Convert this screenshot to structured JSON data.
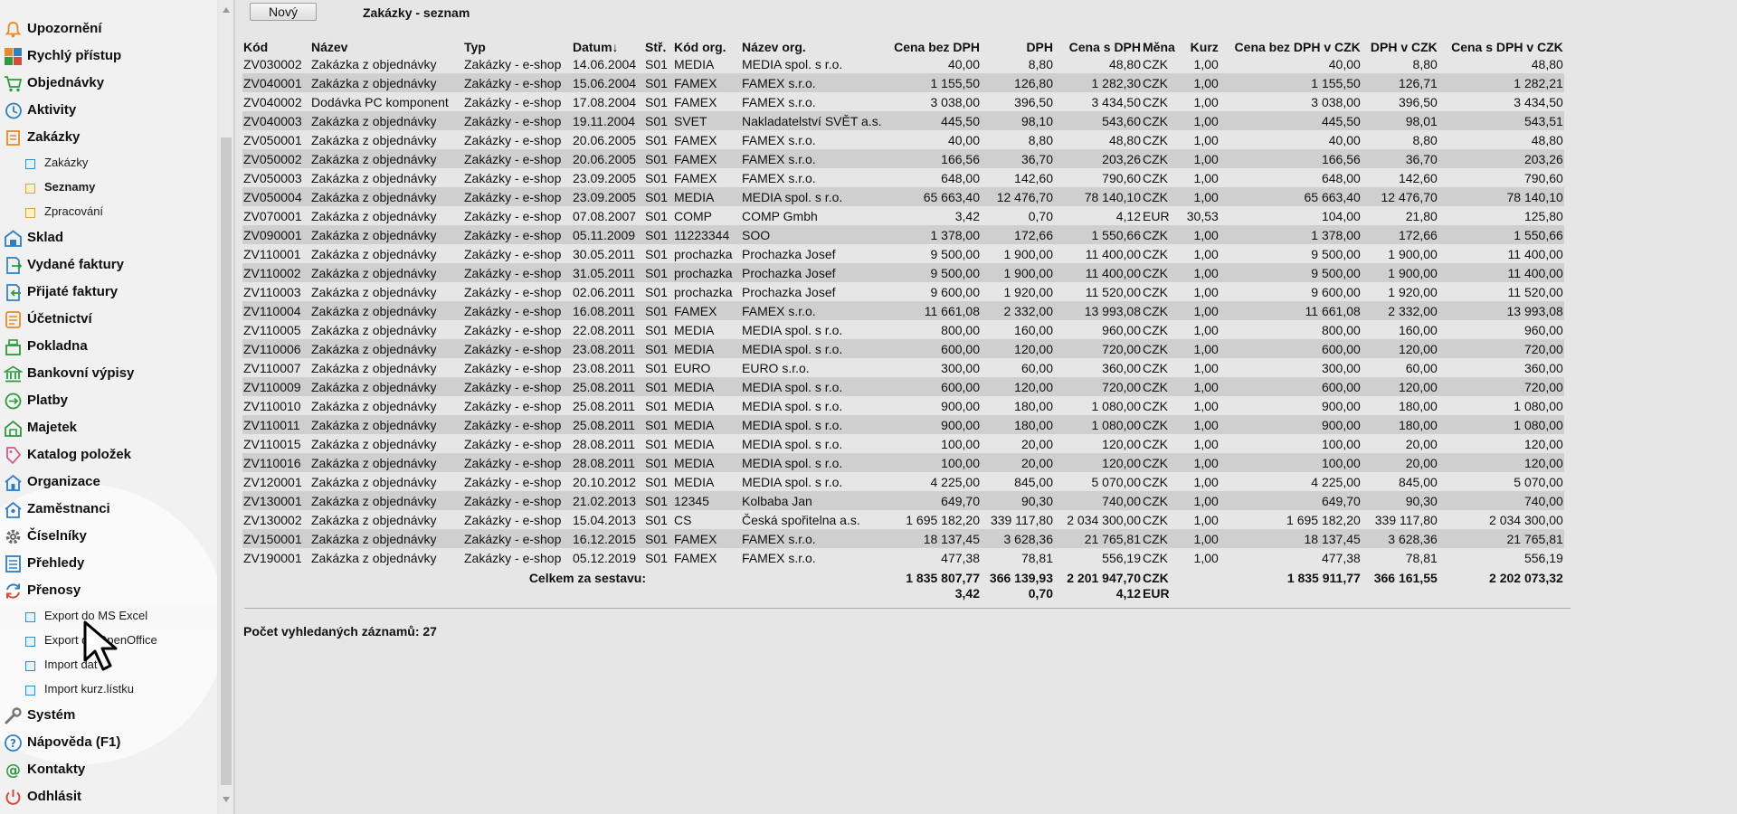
{
  "sidebar": {
    "items": [
      {
        "label": "Upozornění",
        "icon": "bell-icon",
        "name": "sidebar-item-upozorneni"
      },
      {
        "label": "Rychlý přístup",
        "icon": "quick-access-grid-icon",
        "name": "sidebar-item-rychly-pristup"
      },
      {
        "label": "Objednávky",
        "icon": "shopping-cart-icon",
        "name": "sidebar-item-objednavky"
      },
      {
        "label": "Aktivity",
        "icon": "clock-icon",
        "name": "sidebar-item-aktivity"
      },
      {
        "label": "Zakázky",
        "icon": "orders-icon",
        "name": "sidebar-item-zakazky"
      },
      {
        "label": "Zakázky",
        "icon": "document-icon",
        "name": "sidebar-subitem-zakazky",
        "sub": true
      },
      {
        "label": "Seznamy",
        "icon": "folder-icon",
        "name": "sidebar-subitem-seznamy",
        "sub": true,
        "bold": true
      },
      {
        "label": "Zpracování",
        "icon": "folder-icon",
        "name": "sidebar-subitem-zpracovani",
        "sub": true
      },
      {
        "label": "Sklad",
        "icon": "warehouse-icon",
        "name": "sidebar-item-sklad"
      },
      {
        "label": "Vydané faktury",
        "icon": "issued-invoice-icon",
        "name": "sidebar-item-vydane-faktury"
      },
      {
        "label": "Přijaté faktury",
        "icon": "received-invoice-icon",
        "name": "sidebar-item-prijate-faktury"
      },
      {
        "label": "Účetnictví",
        "icon": "accounting-icon",
        "name": "sidebar-item-ucetnictvi"
      },
      {
        "label": "Pokladna",
        "icon": "cash-register-icon",
        "name": "sidebar-item-pokladna"
      },
      {
        "label": "Bankovní výpisy",
        "icon": "bank-icon",
        "name": "sidebar-item-bankovni-vypisy"
      },
      {
        "label": "Platby",
        "icon": "payments-icon",
        "name": "sidebar-item-platby"
      },
      {
        "label": "Majetek",
        "icon": "property-icon",
        "name": "sidebar-item-majetek"
      },
      {
        "label": "Katalog položek",
        "icon": "tag-icon",
        "name": "sidebar-item-katalog-polozek"
      },
      {
        "label": "Organizace",
        "icon": "organization-icon",
        "name": "sidebar-item-organizace"
      },
      {
        "label": "Zaměstnanci",
        "icon": "employees-icon",
        "name": "sidebar-item-zamestnanci"
      },
      {
        "label": "Číselníky",
        "icon": "gear-icon",
        "name": "sidebar-item-ciselniky"
      },
      {
        "label": "Přehledy",
        "icon": "overview-icon",
        "name": "sidebar-item-prehledy"
      },
      {
        "label": "Přenosy",
        "icon": "transfer-icon",
        "name": "sidebar-item-prenosy"
      },
      {
        "label": "Export do MS Excel",
        "icon": "document-icon",
        "name": "sidebar-subitem-export-ms-excel",
        "sub": true,
        "highlight": true
      },
      {
        "label": "Export do OpenOffice",
        "icon": "document-icon",
        "name": "sidebar-subitem-export-openoffice",
        "sub": true
      },
      {
        "label": "Import dat",
        "icon": "document-icon",
        "name": "sidebar-subitem-import-dat",
        "sub": true
      },
      {
        "label": "Import kurz.lístku",
        "icon": "document-icon",
        "name": "sidebar-subitem-import-kurz-listku",
        "sub": true
      },
      {
        "label": "Systém",
        "icon": "wrench-icon",
        "name": "sidebar-item-system"
      },
      {
        "label": "Nápověda (F1)",
        "icon": "help-icon",
        "name": "sidebar-item-napoveda"
      },
      {
        "label": "Kontakty",
        "icon": "at-icon",
        "name": "sidebar-item-kontakty"
      },
      {
        "label": "Odhlásit",
        "icon": "power-icon",
        "name": "sidebar-item-odhlasit"
      }
    ]
  },
  "toolbar": {
    "new_label": "Nový"
  },
  "page": {
    "title": "Zakázky - seznam"
  },
  "colors": {
    "accent_blue": "#2f7fc1",
    "accent_orange": "#e8892a",
    "accent_green": "#2e9a3e",
    "row_stripe": "#cfcfcf"
  },
  "table": {
    "columns": [
      "Kód",
      "Název",
      "Typ",
      "Datum↓",
      "Stř.",
      "Kód org.",
      "Název org.",
      "Cena bez DPH",
      "DPH",
      "Cena s DPH",
      "Měna",
      "Kurz",
      "Cena bez DPH v CZK",
      "DPH v CZK",
      "Cena s DPH v CZK"
    ],
    "rows": [
      [
        "ZV030002",
        "Zakázka z objednávky",
        "Zakázky - e-shop",
        "14.06.2004",
        "S01",
        "MEDIA",
        "MEDIA spol. s r.o.",
        "40,00",
        "8,80",
        "48,80",
        "CZK",
        "1,00",
        "40,00",
        "8,80",
        "48,80"
      ],
      [
        "ZV040001",
        "Zakázka z objednávky",
        "Zakázky - e-shop",
        "15.06.2004",
        "S01",
        "FAMEX",
        "FAMEX s.r.o.",
        "1 155,50",
        "126,80",
        "1 282,30",
        "CZK",
        "1,00",
        "1 155,50",
        "126,71",
        "1 282,21"
      ],
      [
        "ZV040002",
        "Dodávka PC komponent",
        "Zakázky - e-shop",
        "17.08.2004",
        "S01",
        "FAMEX",
        "FAMEX s.r.o.",
        "3 038,00",
        "396,50",
        "3 434,50",
        "CZK",
        "1,00",
        "3 038,00",
        "396,50",
        "3 434,50"
      ],
      [
        "ZV040003",
        "Zakázka z objednávky",
        "Zakázky - e-shop",
        "19.11.2004",
        "S01",
        "SVET",
        "Nakladatelství SVĚT a.s.",
        "445,50",
        "98,10",
        "543,60",
        "CZK",
        "1,00",
        "445,50",
        "98,01",
        "543,51"
      ],
      [
        "ZV050001",
        "Zakázka z objednávky",
        "Zakázky - e-shop",
        "20.06.2005",
        "S01",
        "FAMEX",
        "FAMEX s.r.o.",
        "40,00",
        "8,80",
        "48,80",
        "CZK",
        "1,00",
        "40,00",
        "8,80",
        "48,80"
      ],
      [
        "ZV050002",
        "Zakázka z objednávky",
        "Zakázky - e-shop",
        "20.06.2005",
        "S01",
        "FAMEX",
        "FAMEX s.r.o.",
        "166,56",
        "36,70",
        "203,26",
        "CZK",
        "1,00",
        "166,56",
        "36,70",
        "203,26"
      ],
      [
        "ZV050003",
        "Zakázka z objednávky",
        "Zakázky - e-shop",
        "23.09.2005",
        "S01",
        "FAMEX",
        "FAMEX s.r.o.",
        "648,00",
        "142,60",
        "790,60",
        "CZK",
        "1,00",
        "648,00",
        "142,60",
        "790,60"
      ],
      [
        "ZV050004",
        "Zakázka z objednávky",
        "Zakázky - e-shop",
        "23.09.2005",
        "S01",
        "MEDIA",
        "MEDIA spol. s r.o.",
        "65 663,40",
        "12 476,70",
        "78 140,10",
        "CZK",
        "1,00",
        "65 663,40",
        "12 476,70",
        "78 140,10"
      ],
      [
        "ZV070001",
        "Zakázka z objednávky",
        "Zakázky - e-shop",
        "07.08.2007",
        "S01",
        "COMP",
        "COMP Gmbh",
        "3,42",
        "0,70",
        "4,12",
        "EUR",
        "30,53",
        "104,00",
        "21,80",
        "125,80"
      ],
      [
        "ZV090001",
        "Zakázka z objednávky",
        "Zakázky - e-shop",
        "05.11.2009",
        "S01",
        "11223344",
        "SOO",
        "1 378,00",
        "172,66",
        "1 550,66",
        "CZK",
        "1,00",
        "1 378,00",
        "172,66",
        "1 550,66"
      ],
      [
        "ZV110001",
        "Zakázka z objednávky",
        "Zakázky - e-shop",
        "30.05.2011",
        "S01",
        "prochazka",
        "Prochazka Josef",
        "9 500,00",
        "1 900,00",
        "11 400,00",
        "CZK",
        "1,00",
        "9 500,00",
        "1 900,00",
        "11 400,00"
      ],
      [
        "ZV110002",
        "Zakázka z objednávky",
        "Zakázky - e-shop",
        "31.05.2011",
        "S01",
        "prochazka",
        "Prochazka Josef",
        "9 500,00",
        "1 900,00",
        "11 400,00",
        "CZK",
        "1,00",
        "9 500,00",
        "1 900,00",
        "11 400,00"
      ],
      [
        "ZV110003",
        "Zakázka z objednávky",
        "Zakázky - e-shop",
        "02.06.2011",
        "S01",
        "prochazka",
        "Prochazka Josef",
        "9 600,00",
        "1 920,00",
        "11 520,00",
        "CZK",
        "1,00",
        "9 600,00",
        "1 920,00",
        "11 520,00"
      ],
      [
        "ZV110004",
        "Zakázka z objednávky",
        "Zakázky - e-shop",
        "16.08.2011",
        "S01",
        "FAMEX",
        "FAMEX s.r.o.",
        "11 661,08",
        "2 332,00",
        "13 993,08",
        "CZK",
        "1,00",
        "11 661,08",
        "2 332,00",
        "13 993,08"
      ],
      [
        "ZV110005",
        "Zakázka z objednávky",
        "Zakázky - e-shop",
        "22.08.2011",
        "S01",
        "MEDIA",
        "MEDIA spol. s r.o.",
        "800,00",
        "160,00",
        "960,00",
        "CZK",
        "1,00",
        "800,00",
        "160,00",
        "960,00"
      ],
      [
        "ZV110006",
        "Zakázka z objednávky",
        "Zakázky - e-shop",
        "23.08.2011",
        "S01",
        "MEDIA",
        "MEDIA spol. s r.o.",
        "600,00",
        "120,00",
        "720,00",
        "CZK",
        "1,00",
        "600,00",
        "120,00",
        "720,00"
      ],
      [
        "ZV110007",
        "Zakázka z objednávky",
        "Zakázky - e-shop",
        "23.08.2011",
        "S01",
        "EURO",
        "EURO s.r.o.",
        "300,00",
        "60,00",
        "360,00",
        "CZK",
        "1,00",
        "300,00",
        "60,00",
        "360,00"
      ],
      [
        "ZV110009",
        "Zakázka z objednávky",
        "Zakázky - e-shop",
        "25.08.2011",
        "S01",
        "MEDIA",
        "MEDIA spol. s r.o.",
        "600,00",
        "120,00",
        "720,00",
        "CZK",
        "1,00",
        "600,00",
        "120,00",
        "720,00"
      ],
      [
        "ZV110010",
        "Zakázka z objednávky",
        "Zakázky - e-shop",
        "25.08.2011",
        "S01",
        "MEDIA",
        "MEDIA spol. s r.o.",
        "900,00",
        "180,00",
        "1 080,00",
        "CZK",
        "1,00",
        "900,00",
        "180,00",
        "1 080,00"
      ],
      [
        "ZV110011",
        "Zakázka z objednávky",
        "Zakázky - e-shop",
        "25.08.2011",
        "S01",
        "MEDIA",
        "MEDIA spol. s r.o.",
        "900,00",
        "180,00",
        "1 080,00",
        "CZK",
        "1,00",
        "900,00",
        "180,00",
        "1 080,00"
      ],
      [
        "ZV110015",
        "Zakázka z objednávky",
        "Zakázky - e-shop",
        "28.08.2011",
        "S01",
        "MEDIA",
        "MEDIA spol. s r.o.",
        "100,00",
        "20,00",
        "120,00",
        "CZK",
        "1,00",
        "100,00",
        "20,00",
        "120,00"
      ],
      [
        "ZV110016",
        "Zakázka z objednávky",
        "Zakázky - e-shop",
        "28.08.2011",
        "S01",
        "MEDIA",
        "MEDIA spol. s r.o.",
        "100,00",
        "20,00",
        "120,00",
        "CZK",
        "1,00",
        "100,00",
        "20,00",
        "120,00"
      ],
      [
        "ZV120001",
        "Zakázka z objednávky",
        "Zakázky - e-shop",
        "20.10.2012",
        "S01",
        "MEDIA",
        "MEDIA spol. s r.o.",
        "4 225,00",
        "845,00",
        "5 070,00",
        "CZK",
        "1,00",
        "4 225,00",
        "845,00",
        "5 070,00"
      ],
      [
        "ZV130001",
        "Zakázka z objednávky",
        "Zakázky - e-shop",
        "21.02.2013",
        "S01",
        "12345",
        "Kolbaba Jan",
        "649,70",
        "90,30",
        "740,00",
        "CZK",
        "1,00",
        "649,70",
        "90,30",
        "740,00"
      ],
      [
        "ZV130002",
        "Zakázka z objednávky",
        "Zakázky - e-shop",
        "15.04.2013",
        "S01",
        "CS",
        "Česká spořitelna a.s.",
        "1 695 182,20",
        "339 117,80",
        "2 034 300,00",
        "CZK",
        "1,00",
        "1 695 182,20",
        "339 117,80",
        "2 034 300,00"
      ],
      [
        "ZV150001",
        "Zakázka z objednávky",
        "Zakázky - e-shop",
        "16.12.2015",
        "S01",
        "FAMEX",
        "FAMEX s.r.o.",
        "18 137,45",
        "3 628,36",
        "21 765,81",
        "CZK",
        "1,00",
        "18 137,45",
        "3 628,36",
        "21 765,81"
      ],
      [
        "ZV190001",
        "Zakázka z objednávky",
        "Zakázky - e-shop",
        "05.12.2019",
        "S01",
        "FAMEX",
        "FAMEX s.r.o.",
        "477,38",
        "78,81",
        "556,19",
        "CZK",
        "1,00",
        "477,38",
        "78,81",
        "556,19"
      ]
    ],
    "totals": {
      "label": "Celkem za sestavu:",
      "price_wo_vat": [
        "1 835 807,77",
        "3,42"
      ],
      "vat": [
        "366 139,93",
        "0,70"
      ],
      "price_w_vat": [
        "2 201 947,70",
        "4,12"
      ],
      "currency": [
        "CZK",
        "EUR"
      ],
      "price_wo_vat_czk": "1 835 911,77",
      "vat_czk": "366 161,55",
      "price_w_vat_czk": "2 202 073,32"
    }
  },
  "footer": {
    "record_count": "Počet vyhledaných záznamů: 27"
  }
}
